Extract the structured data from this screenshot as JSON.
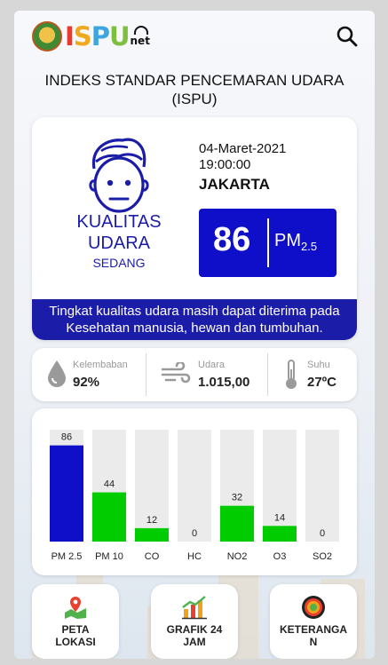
{
  "app": {
    "logo_text_parts": [
      "I",
      "S",
      "P",
      "U"
    ],
    "logo_suffix": "net"
  },
  "header": {
    "title_line1": "INDEKS STANDAR PENCEMARAN UDARA",
    "title_line2": "(ISPU)",
    "search_icon": "search-icon"
  },
  "summary": {
    "quality_line1": "KUALITAS",
    "quality_line2": "UDARA",
    "quality_status": "SEDANG",
    "date": "04-Maret-2021",
    "time": "19:00:00",
    "city": "JAKARTA",
    "aqi_value": "86",
    "aqi_param": "PM",
    "aqi_param_sub": "2.5",
    "description_line1": "Tingkat kualitas udara masih dapat diterima pada",
    "description_line2": "Kesehatan manusia, hewan dan tumbuhan.",
    "accent_color": "#1b1ca8",
    "box_color": "#0f0fc9"
  },
  "weather": [
    {
      "label": "Kelembaban",
      "value": "92%",
      "icon": "humidity-drop-icon"
    },
    {
      "label": "Udara",
      "value": "1.015,00",
      "icon": "wind-icon"
    },
    {
      "label": "Suhu",
      "value": "27ºC",
      "icon": "thermometer-icon"
    }
  ],
  "chart_data": {
    "type": "bar",
    "categories": [
      "PM 2.5",
      "PM 10",
      "CO",
      "HC",
      "NO2",
      "O3",
      "SO2"
    ],
    "values": [
      86,
      44,
      12,
      0,
      32,
      14,
      0
    ],
    "bar_colors": [
      "#0f0fc9",
      "#00cc00",
      "#00cc00",
      "#00cc00",
      "#00cc00",
      "#00cc00",
      "#00cc00"
    ],
    "ylim": [
      0,
      100
    ],
    "grid": false
  },
  "nav": [
    {
      "label_line1": "PETA",
      "label_line2": "LOKASI",
      "icon": "map-pin-icon"
    },
    {
      "label_line1": "GRAFIK 24",
      "label_line2": "JAM",
      "icon": "bar-chart-icon"
    },
    {
      "label_line1": "KETERANGA",
      "label_line2": "N",
      "icon": "info-legend-icon"
    }
  ]
}
